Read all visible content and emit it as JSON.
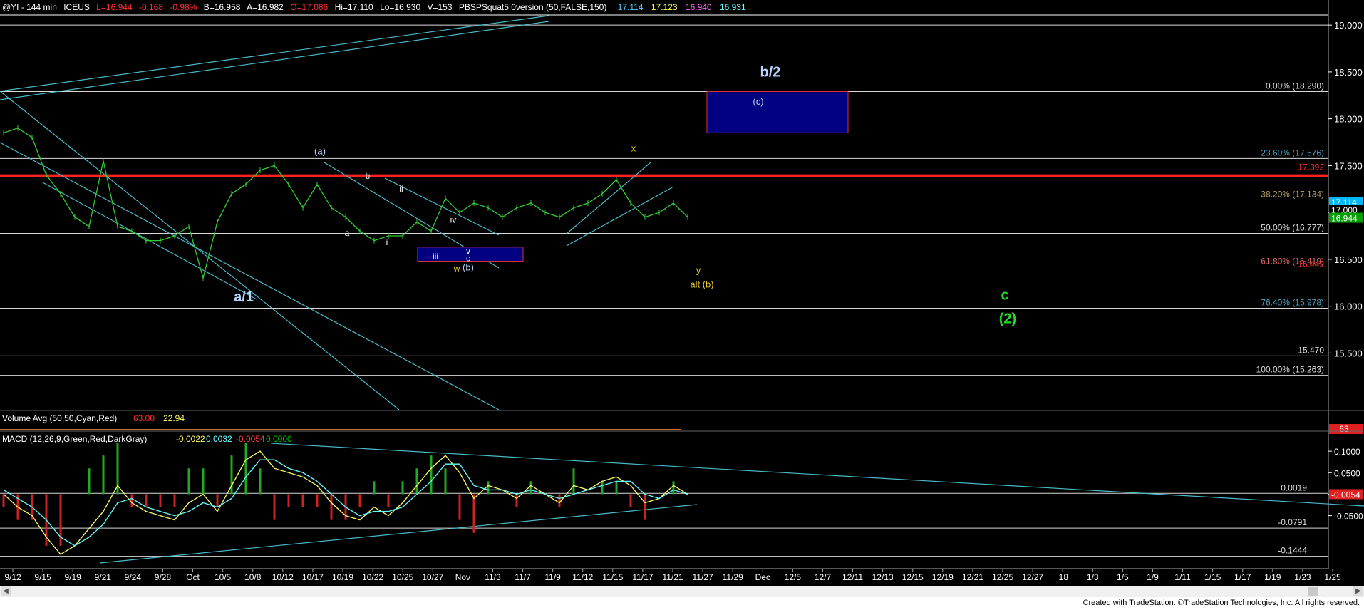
{
  "header": {
    "symbol": "@YI - 144 min",
    "exchange": "ICEUS",
    "last": "L=16.944",
    "change": "-0.168",
    "change_pct": "-0.98%",
    "bid": "B=16.958",
    "ask": "A=16.982",
    "open": "O=17.086",
    "high": "Hi=17.110",
    "low": "Lo=16.930",
    "volume": "V=153",
    "study": "PBSPSquat5.0version (50,FALSE,150)",
    "study_vals": [
      "17.114",
      "17.123",
      "16.940",
      "16.931"
    ],
    "study_colors": [
      "#4fd0ff",
      "#ffff66",
      "#ff66ff",
      "#66ffff"
    ]
  },
  "chart_data": [
    {
      "type": "line",
      "name": "price",
      "y_axis_ticks": [
        "19.000",
        "18.500",
        "18.000",
        "17.500",
        "17.000",
        "16.500",
        "16.000",
        "15.500"
      ],
      "ylim": [
        15.1,
        19.1
      ],
      "x_axis_ticks": [
        "9/12",
        "9/15",
        "9/19",
        "9/21",
        "9/24",
        "9/28",
        "Oct",
        "10/5",
        "10/8",
        "10/12",
        "10/17",
        "10/19",
        "10/22",
        "10/25",
        "10/27",
        "Nov",
        "11/3",
        "11/7",
        "11/9",
        "11/12",
        "11/15",
        "11/17",
        "11/21",
        "11/27",
        "11/29",
        "Dec",
        "12/5",
        "12/7",
        "12/11",
        "12/13",
        "12/15",
        "12/19",
        "12/21",
        "12/25",
        "12/27",
        "'18",
        "1/3",
        "1/5",
        "1/9",
        "1/11",
        "1/15",
        "1/17",
        "1/19",
        "1/23",
        "1/25"
      ],
      "x": [
        0,
        4,
        8,
        12,
        16,
        20,
        24,
        28,
        32,
        36,
        40,
        44,
        48,
        52,
        56,
        60,
        64,
        68,
        72,
        76,
        80,
        84,
        88,
        92,
        96,
        100,
        104,
        108,
        112,
        116,
        120,
        124,
        128,
        132,
        136,
        140,
        144,
        148,
        152,
        156,
        160,
        164,
        168,
        172,
        176,
        180,
        184,
        188,
        192
      ],
      "y": [
        17.85,
        17.9,
        17.8,
        17.4,
        17.2,
        16.95,
        16.85,
        17.55,
        16.85,
        16.8,
        16.7,
        16.7,
        16.75,
        16.85,
        16.3,
        16.9,
        17.2,
        17.3,
        17.45,
        17.5,
        17.3,
        17.05,
        17.3,
        17.05,
        16.95,
        16.8,
        16.7,
        16.75,
        16.75,
        16.9,
        16.8,
        17.15,
        17.0,
        17.1,
        17.05,
        16.95,
        17.05,
        17.1,
        17.0,
        16.95,
        17.05,
        17.1,
        17.2,
        17.35,
        17.1,
        16.95,
        17.0,
        17.1,
        16.95
      ],
      "levels": [
        {
          "label": "0.00% (18.290)",
          "value": 18.29
        },
        {
          "label": "23.60% (17.576)",
          "value": 17.576
        },
        {
          "label": "38.20% (17.134)",
          "value": 17.134
        },
        {
          "label": "50.00% (16.777)",
          "value": 16.777
        },
        {
          "label": "61.80% (16.419)",
          "value": 16.419
        },
        {
          "label": "76.40% (15.978)",
          "value": 15.978
        },
        {
          "label": "15.470",
          "value": 15.47
        },
        {
          "label": "100.00% (15.263)",
          "value": 15.263
        }
      ],
      "resistance": {
        "label": "17.392",
        "value": 17.392,
        "color": "#ff2020"
      },
      "support_label": {
        "label": "16.449",
        "value": 16.449
      },
      "last_price_badges": [
        {
          "label": "17.114",
          "value": 17.114,
          "color": "#00b8ff"
        },
        {
          "label": "17.000",
          "value": 17.03,
          "color": "#ffffff"
        },
        {
          "label": "16.944",
          "value": 16.944,
          "color": "#00a000"
        }
      ],
      "annotations": {
        "a1": "a/1",
        "b2": "b/2",
        "c_paren": "(c)",
        "a_paren": "(a)",
        "b_paren": "(b)",
        "w": "w",
        "x": "x",
        "y": "y",
        "alt_b": "alt (b)",
        "c_green": "c",
        "two_green": "(2)",
        "minor_a": "a",
        "minor_b": "b",
        "minor_c": "c",
        "i": "i",
        "ii": "ii",
        "iii": "iii",
        "iv": "iv",
        "v": "v"
      }
    },
    {
      "type": "bar",
      "name": "Volume Avg (50,50,Cyan,Red)",
      "values_label": [
        "63.00",
        "22.94"
      ],
      "badge": "63"
    },
    {
      "type": "line",
      "name": "MACD (12,26,9,Green,Red,DarkGray)",
      "values_label": [
        "-0.0022",
        "0.0032",
        "-0.0054",
        "0.0000"
      ],
      "values_label_colors": [
        "#ffff66",
        "#66ffff",
        "#ff4444",
        "#00c000"
      ],
      "y_axis_ticks": [
        "0.1000",
        "0.0500",
        "0.0000",
        "-0.0500"
      ],
      "ylim": [
        -0.16,
        0.13
      ],
      "levels": [
        {
          "label": "0.0019",
          "value": 0.0019
        },
        {
          "label": "-0.0791",
          "value": -0.0791
        },
        {
          "label": "-0.1444",
          "value": -0.1444
        }
      ],
      "badge": "-0.0054",
      "x": [
        0,
        4,
        8,
        12,
        16,
        20,
        24,
        28,
        32,
        36,
        40,
        44,
        48,
        52,
        56,
        60,
        64,
        68,
        72,
        76,
        80,
        84,
        88,
        92,
        96,
        100,
        104,
        108,
        112,
        116,
        120,
        124,
        128,
        132,
        136,
        140,
        144,
        148,
        152,
        156,
        160,
        164,
        168,
        172,
        176,
        180,
        184,
        188,
        192
      ],
      "macd": [
        0.0,
        -0.03,
        -0.05,
        -0.1,
        -0.14,
        -0.12,
        -0.08,
        -0.04,
        0.02,
        -0.02,
        -0.04,
        -0.05,
        -0.06,
        -0.02,
        0.0,
        -0.04,
        0.02,
        0.08,
        0.1,
        0.06,
        0.05,
        0.04,
        0.02,
        -0.02,
        -0.05,
        -0.06,
        -0.03,
        -0.05,
        -0.02,
        0.02,
        0.06,
        0.09,
        0.05,
        -0.01,
        0.02,
        0.01,
        -0.01,
        0.02,
        0.0,
        -0.02,
        0.02,
        0.01,
        0.03,
        0.04,
        0.02,
        -0.02,
        -0.01,
        0.02,
        0.0
      ],
      "signal": [
        0.01,
        -0.01,
        -0.03,
        -0.06,
        -0.1,
        -0.12,
        -0.1,
        -0.07,
        -0.02,
        -0.01,
        -0.03,
        -0.04,
        -0.05,
        -0.04,
        -0.02,
        -0.03,
        -0.01,
        0.04,
        0.08,
        0.08,
        0.06,
        0.05,
        0.03,
        0.0,
        -0.03,
        -0.05,
        -0.04,
        -0.04,
        -0.03,
        0.0,
        0.03,
        0.07,
        0.07,
        0.02,
        0.01,
        0.01,
        0.0,
        0.01,
        0.0,
        -0.01,
        0.0,
        0.01,
        0.02,
        0.03,
        0.03,
        0.0,
        -0.01,
        0.01,
        0.0
      ]
    }
  ],
  "footer": {
    "credit": "Created with TradeStation. ©TradeStation Technologies, Inc. All rights reserved."
  }
}
